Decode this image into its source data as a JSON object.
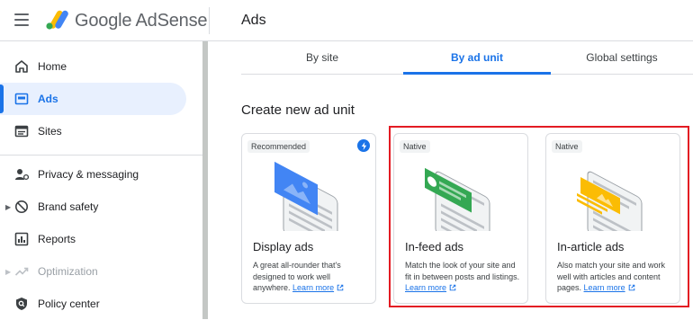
{
  "app": {
    "brand": "Google AdSense",
    "page_title": "Ads"
  },
  "sidebar": {
    "items": [
      {
        "label": "Home",
        "icon": "home-icon"
      },
      {
        "label": "Ads",
        "icon": "ads-icon",
        "active": true
      },
      {
        "label": "Sites",
        "icon": "sites-icon"
      },
      {
        "label": "Privacy & messaging",
        "icon": "privacy-icon"
      },
      {
        "label": "Brand safety",
        "icon": "brand-safety-icon",
        "expandable": true
      },
      {
        "label": "Reports",
        "icon": "reports-icon"
      },
      {
        "label": "Optimization",
        "icon": "optimization-icon",
        "expandable": true,
        "disabled": true
      },
      {
        "label": "Policy center",
        "icon": "policy-icon"
      }
    ]
  },
  "tabs": [
    {
      "label": "By site"
    },
    {
      "label": "By ad unit",
      "active": true
    },
    {
      "label": "Global settings"
    }
  ],
  "section_title": "Create new ad unit",
  "cards": [
    {
      "badge": "Recommended",
      "title": "Display ads",
      "description": "A great all-rounder that's designed to work well anywhere.",
      "link": "Learn more",
      "illustration_color": "#4285f4"
    },
    {
      "badge": "Native",
      "title": "In-feed ads",
      "description": "Match the look of your site and fit in between posts and listings.",
      "link": "Learn more",
      "illustration_color": "#34a853"
    },
    {
      "badge": "Native",
      "title": "In-article ads",
      "description": "Also match your site and work well with articles and content pages.",
      "link": "Learn more",
      "illustration_color": "#fbbc04"
    }
  ],
  "colors": {
    "accent": "#1a73e8",
    "highlight": "#e31b23"
  }
}
